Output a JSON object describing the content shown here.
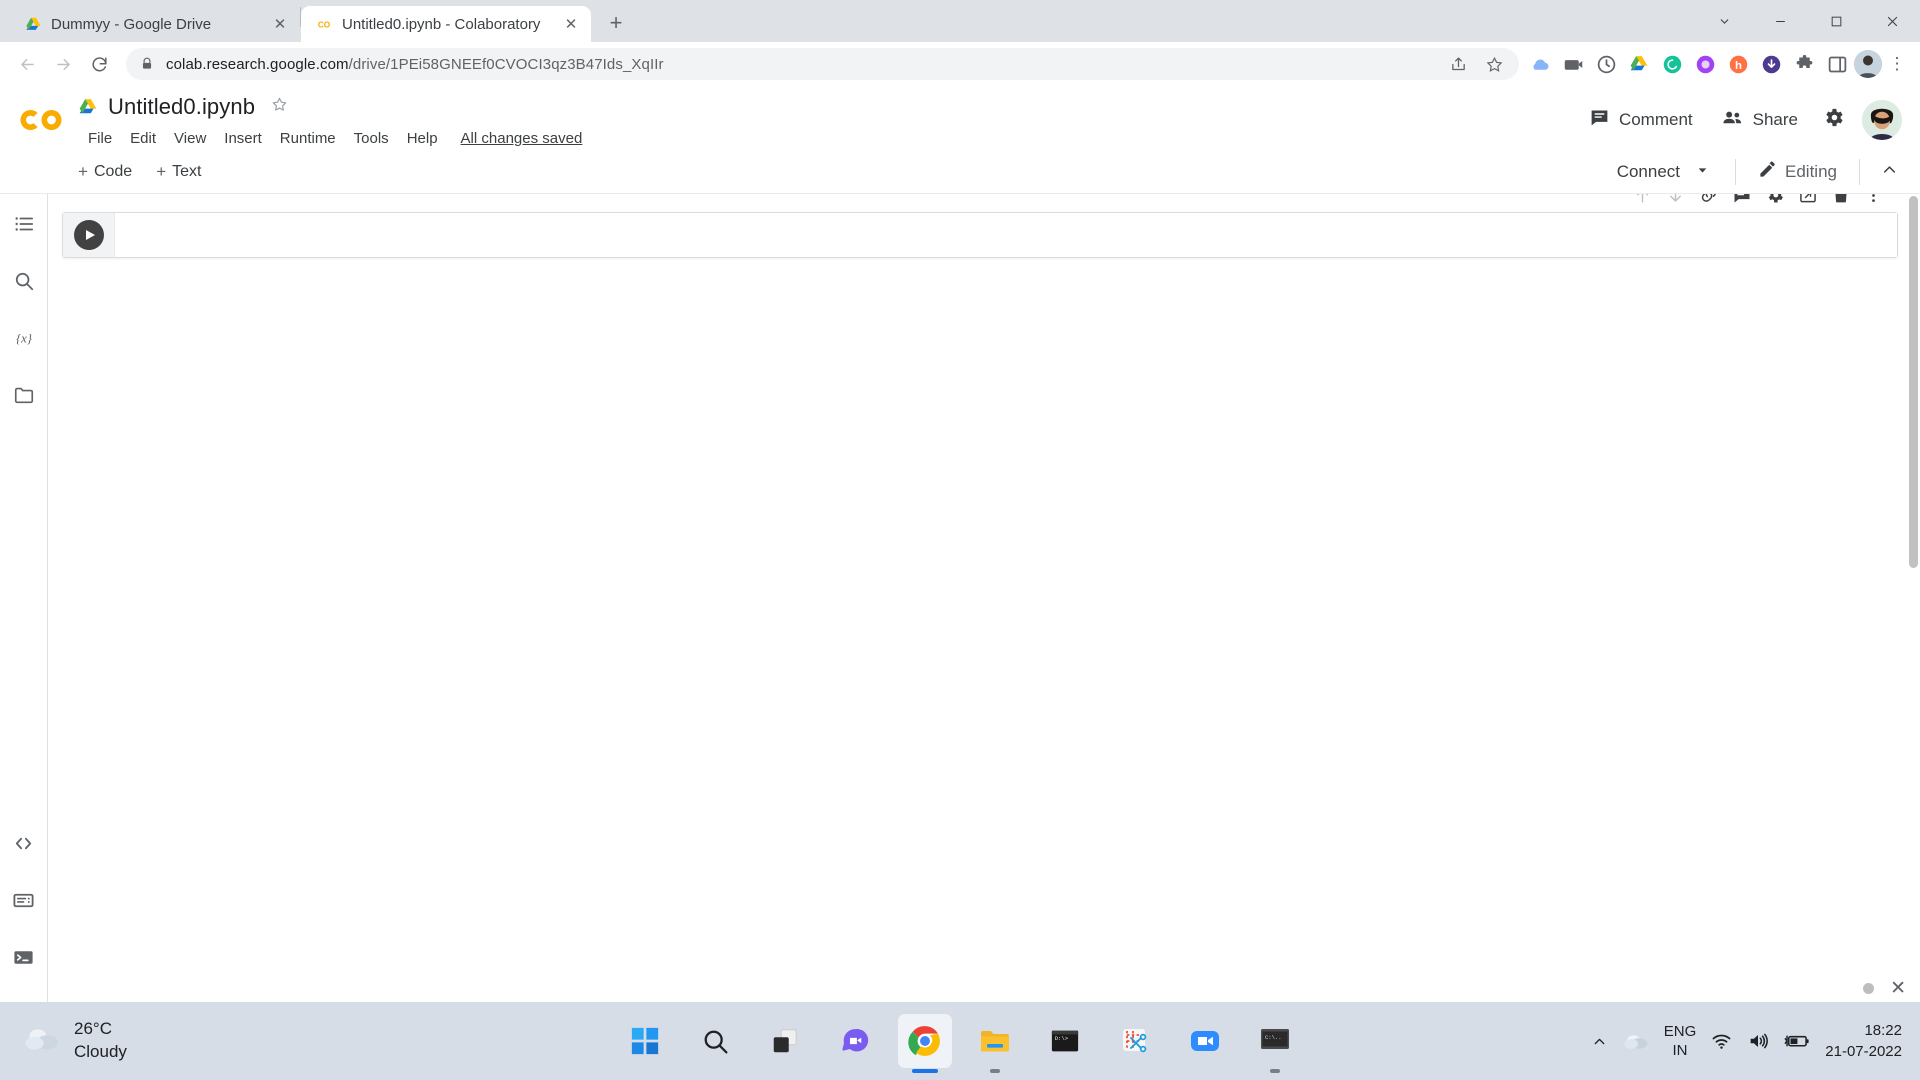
{
  "browser": {
    "tabs": [
      {
        "title": "Dummyy - Google Drive",
        "favicon": "google-drive-icon",
        "active": false
      },
      {
        "title": "Untitled0.ipynb - Colaboratory",
        "favicon": "colab-icon",
        "active": true
      }
    ],
    "new_tab_label": "+",
    "window_controls": {
      "minimize": "–",
      "maximize": "❐",
      "close": "✕",
      "caret": "⌄"
    },
    "nav": {
      "back": "←",
      "forward": "→",
      "reload": "↻"
    },
    "omnibox": {
      "url_host": "colab.research.google.com",
      "url_path": "/drive/1PEi58GNEEf0CVOCI3qz3B47Ids_XqIIr",
      "lock_icon": "lock-icon",
      "share_icon": "share-icon",
      "bookmark_icon": "star-icon"
    },
    "extensions": [
      "cloud-icon",
      "camera-icon",
      "clock-icon",
      "drive-icon",
      "grammarly-icon",
      "purple-circle-icon",
      "honey-icon",
      "download-icon",
      "puzzle-icon",
      "sidepanel-icon"
    ]
  },
  "colab": {
    "logo": "colab-logo",
    "drive_icon": "google-drive-icon",
    "notebook_title": "Untitled0.ipynb",
    "star_icon": "star-outline-icon",
    "menu": [
      "File",
      "Edit",
      "View",
      "Insert",
      "Runtime",
      "Tools",
      "Help"
    ],
    "save_status": "All changes saved",
    "header_actions": {
      "comment_label": "Comment",
      "comment_icon": "comment-icon",
      "share_label": "Share",
      "share_icon": "people-icon",
      "settings_icon": "gear-icon",
      "avatar": "user-avatar"
    },
    "toolbar": {
      "add_code_label": "Code",
      "add_text_label": "Text",
      "plus": "+",
      "connect_label": "Connect",
      "connect_caret": "▾",
      "editing_label": "Editing",
      "editing_icon": "pencil-icon",
      "collapse_icon": "chevron-up-icon"
    },
    "sidebar": {
      "top_items": [
        {
          "name": "table-of-contents",
          "icon": "list-icon"
        },
        {
          "name": "find-and-replace",
          "icon": "search-icon"
        },
        {
          "name": "variables",
          "icon": "variables-icon",
          "glyph": "{x}"
        },
        {
          "name": "files",
          "icon": "folder-icon"
        }
      ],
      "bottom_items": [
        {
          "name": "code-snippets",
          "icon": "code-brackets-icon",
          "glyph": "< >"
        },
        {
          "name": "command-palette",
          "icon": "command-palette-icon"
        },
        {
          "name": "terminal",
          "icon": "terminal-icon"
        }
      ]
    },
    "cell": {
      "run_button": "run-cell-button",
      "code_value": "",
      "tools": [
        {
          "name": "move-cell-up",
          "icon": "arrow-up-icon",
          "disabled": true
        },
        {
          "name": "move-cell-down",
          "icon": "arrow-down-icon",
          "disabled": true
        },
        {
          "name": "link-to-cell",
          "icon": "link-icon",
          "disabled": false
        },
        {
          "name": "add-comment",
          "icon": "comment-icon",
          "disabled": false
        },
        {
          "name": "cell-settings",
          "icon": "gear-icon",
          "disabled": false
        },
        {
          "name": "mirror-cell-in-tab",
          "icon": "open-in-tab-icon",
          "disabled": false
        },
        {
          "name": "delete-cell",
          "icon": "trash-icon",
          "disabled": false
        },
        {
          "name": "more-cell-actions",
          "icon": "more-vert-icon",
          "disabled": false
        }
      ]
    },
    "status_bar": {
      "dot": "status-dot",
      "close": "✕"
    }
  },
  "taskbar": {
    "weather": {
      "temperature": "26°C",
      "condition": "Cloudy",
      "icon": "cloud-icon"
    },
    "apps": [
      {
        "name": "start",
        "icon": "windows-logo-icon",
        "active": false
      },
      {
        "name": "search",
        "icon": "search-icon",
        "active": false
      },
      {
        "name": "task-view",
        "icon": "task-view-icon",
        "active": false
      },
      {
        "name": "chat",
        "icon": "chat-icon",
        "active": false
      },
      {
        "name": "google-chrome",
        "icon": "chrome-icon",
        "active": true
      },
      {
        "name": "file-explorer",
        "icon": "folder-icon",
        "active": false
      },
      {
        "name": "terminal",
        "icon": "terminal-icon",
        "active": false
      },
      {
        "name": "snipping-tool",
        "icon": "scissors-icon",
        "active": false
      },
      {
        "name": "zoom",
        "icon": "video-camera-icon",
        "active": false
      },
      {
        "name": "command-prompt",
        "icon": "cmd-icon",
        "active": false
      }
    ],
    "tray": {
      "overflow_icon": "chevron-up-icon",
      "cloud_icon": "cloud-icon",
      "language_line1": "ENG",
      "language_line2": "IN",
      "wifi_icon": "wifi-icon",
      "volume_icon": "volume-icon",
      "battery_icon": "battery-charging-icon",
      "time": "18:22",
      "date": "21-07-2022"
    }
  }
}
